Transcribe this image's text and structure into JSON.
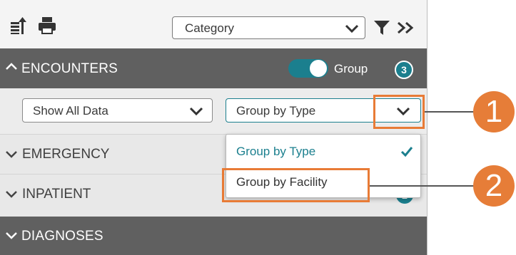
{
  "toolbar": {
    "category_value": "Category",
    "icons": [
      "sort-icon",
      "print-icon",
      "filter-icon",
      "expand-icon"
    ]
  },
  "encounters": {
    "title": "ENCOUNTERS",
    "group_toggle_label": "Group",
    "group_toggle_on": true,
    "count_badge": "3",
    "filter_select_value": "Show All Data",
    "group_select_value": "Group by Type",
    "group_options": [
      {
        "label": "Group by Type",
        "selected": true
      },
      {
        "label": "Group by Facility",
        "selected": false
      }
    ]
  },
  "sections": {
    "emergency": "EMERGENCY",
    "inpatient": "INPATIENT",
    "inpatient_badge": "2",
    "diagnoses": "DIAGNOSES"
  },
  "callouts": [
    "1",
    "2"
  ],
  "colors": {
    "header_bg": "#606060",
    "accent_teal": "#1b7f8e",
    "callout_orange": "#e67d38"
  }
}
